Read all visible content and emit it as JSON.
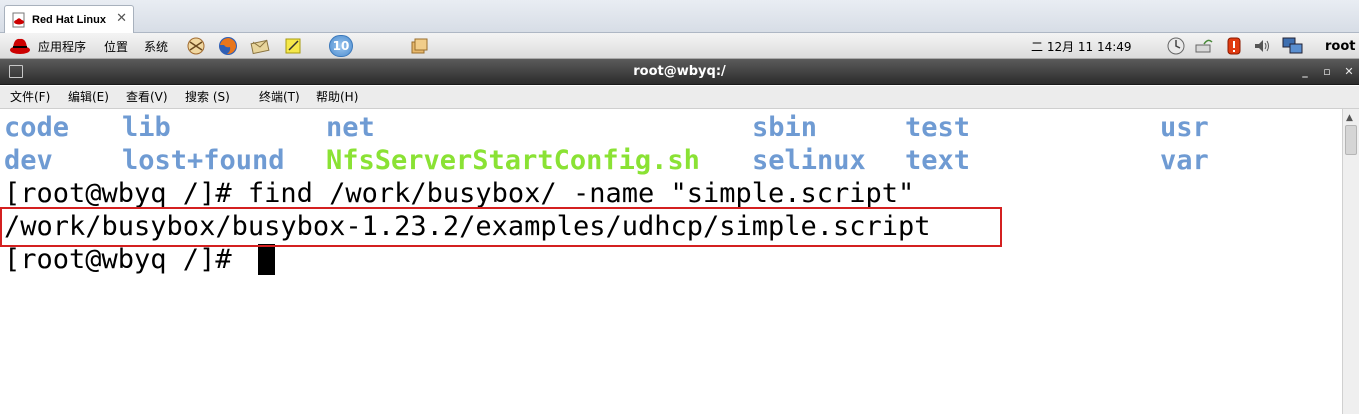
{
  "tab": {
    "label": "Red Hat Linux",
    "close": "✕",
    "icon": "redhat-document-icon"
  },
  "panel": {
    "menus": [
      "应用程序",
      "位置",
      "系统"
    ],
    "launcher_badge": "10",
    "clock": "二 12月 11 14:49",
    "user": "root",
    "icons": [
      "redhat-logo-icon",
      "network-game-icon",
      "firefox-icon",
      "mail-client-icon",
      "notes-icon",
      "workspace-badge-icon",
      "files-app-icon",
      "power-manager-icon",
      "network-monitor-icon",
      "alert-icon",
      "volume-icon",
      "network-connection-icon"
    ]
  },
  "window": {
    "title": "root@wbyq:/",
    "buttons": {
      "minimize": "_",
      "maximize": "▫",
      "close": "✕"
    }
  },
  "menubar": [
    "文件(F)",
    "编辑(E)",
    "查看(V)",
    "搜索 (S)",
    "终端(T)",
    "帮助(H)"
  ],
  "terminal": {
    "listing": [
      [
        {
          "name": "code",
          "kind": "dir"
        },
        {
          "name": "lib",
          "kind": "dir"
        },
        {
          "name": "net",
          "kind": "dir"
        },
        {
          "name": "sbin",
          "kind": "dir"
        },
        {
          "name": "test",
          "kind": "dir"
        },
        {
          "name": "usr",
          "kind": "dir"
        }
      ],
      [
        {
          "name": "dev",
          "kind": "dir"
        },
        {
          "name": "lost+found",
          "kind": "dir"
        },
        {
          "name": "NfsServerStartConfig.sh",
          "kind": "exe"
        },
        {
          "name": "selinux",
          "kind": "dir"
        },
        {
          "name": "text",
          "kind": "dir"
        },
        {
          "name": "var",
          "kind": "dir"
        }
      ]
    ],
    "command_line": "[root@wbyq /]# find /work/busybox/ -name \"simple.script\"",
    "result_line": "/work/busybox/busybox-1.23.2/examples/udhcp/simple.script",
    "prompt_line": "[root@wbyq /]# "
  },
  "colors": {
    "directory": "#6f9bd3",
    "executable": "#8ae234",
    "highlight_box": "#d42020",
    "titlebar": "#3a3a3a"
  }
}
